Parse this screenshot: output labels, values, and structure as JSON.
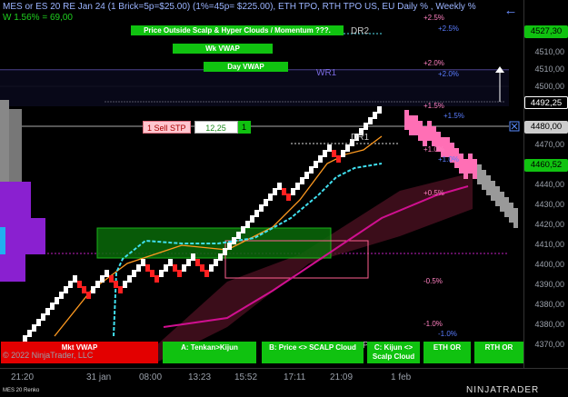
{
  "header": {
    "title": "MES or ES 20 RE Jan 24 (1 Brick=5p=$25.00) (1%=45p= $225.00), ETH TPO, RTH TPO US, EU Daily % , Weekly %",
    "weekly_change": "W 1.56% = 69,00"
  },
  "buttons_top": {
    "scalp": "Price Outside Scalp & Hyper Clouds / Momentum ???.",
    "wk_vwap": "Wk VWAP",
    "day_vwap": "Day VWAP"
  },
  "levels": {
    "dr2": "DR2",
    "wr1": "WR1",
    "dr1": "DR1",
    "dpp": "DPP"
  },
  "pct_right": [
    "+2.5%",
    "+2.0%",
    "+1.5%",
    "+1.0%",
    "-0.5%",
    "-1.0%"
  ],
  "pct_left": [
    "+2.5%",
    "+2.0%",
    "+1.5%",
    "+1.0%",
    "+0.5%",
    "-0.5%",
    "-1.0%"
  ],
  "price_axis": [
    "4530,00",
    "4510,00",
    "4500,00",
    "4490,00",
    "4470,00",
    "4450,00",
    "4440,00",
    "4430,00",
    "4420,00",
    "4410,00",
    "4400,00",
    "4390,00",
    "4380,00",
    "4370,00"
  ],
  "price_tags": {
    "top": "4527,30",
    "current": "4492,25",
    "stop": "4480,00",
    "last": "4460,52"
  },
  "order": {
    "label": "1 Sell STP",
    "qty": "12,25",
    "count": "1"
  },
  "time_axis": [
    "21:20",
    "31 jan",
    "08:00",
    "13:23",
    "15:52",
    "17:11",
    "21:09",
    "1 feb"
  ],
  "bottom_buttons": {
    "mkt_vwap": "Mkt VWAP",
    "tenkan": "A: Tenkan>Kijun",
    "scalp_cloud": "B: Price <> SCALP Cloud",
    "kijun_scalp": "C: Kijun <> Scalp Cloud",
    "eth_or": "ETH OR",
    "rth_or": "RTH OR"
  },
  "copyright": "© 2022 NinjaTrader, LLC",
  "footer_left": "MES 20 Renko",
  "brand": "NINJATRADER",
  "colors": {
    "background": "#000000",
    "bull_brick": "#ffffff",
    "bear_brick": "#ff0000",
    "green": "#10c210",
    "cyan": "#40e0f0",
    "magenta": "#d01090",
    "orange": "#ff9a20",
    "pink": "#ff6fb5",
    "purple": "#8a20d0",
    "price_tag_green": "#10c210"
  }
}
